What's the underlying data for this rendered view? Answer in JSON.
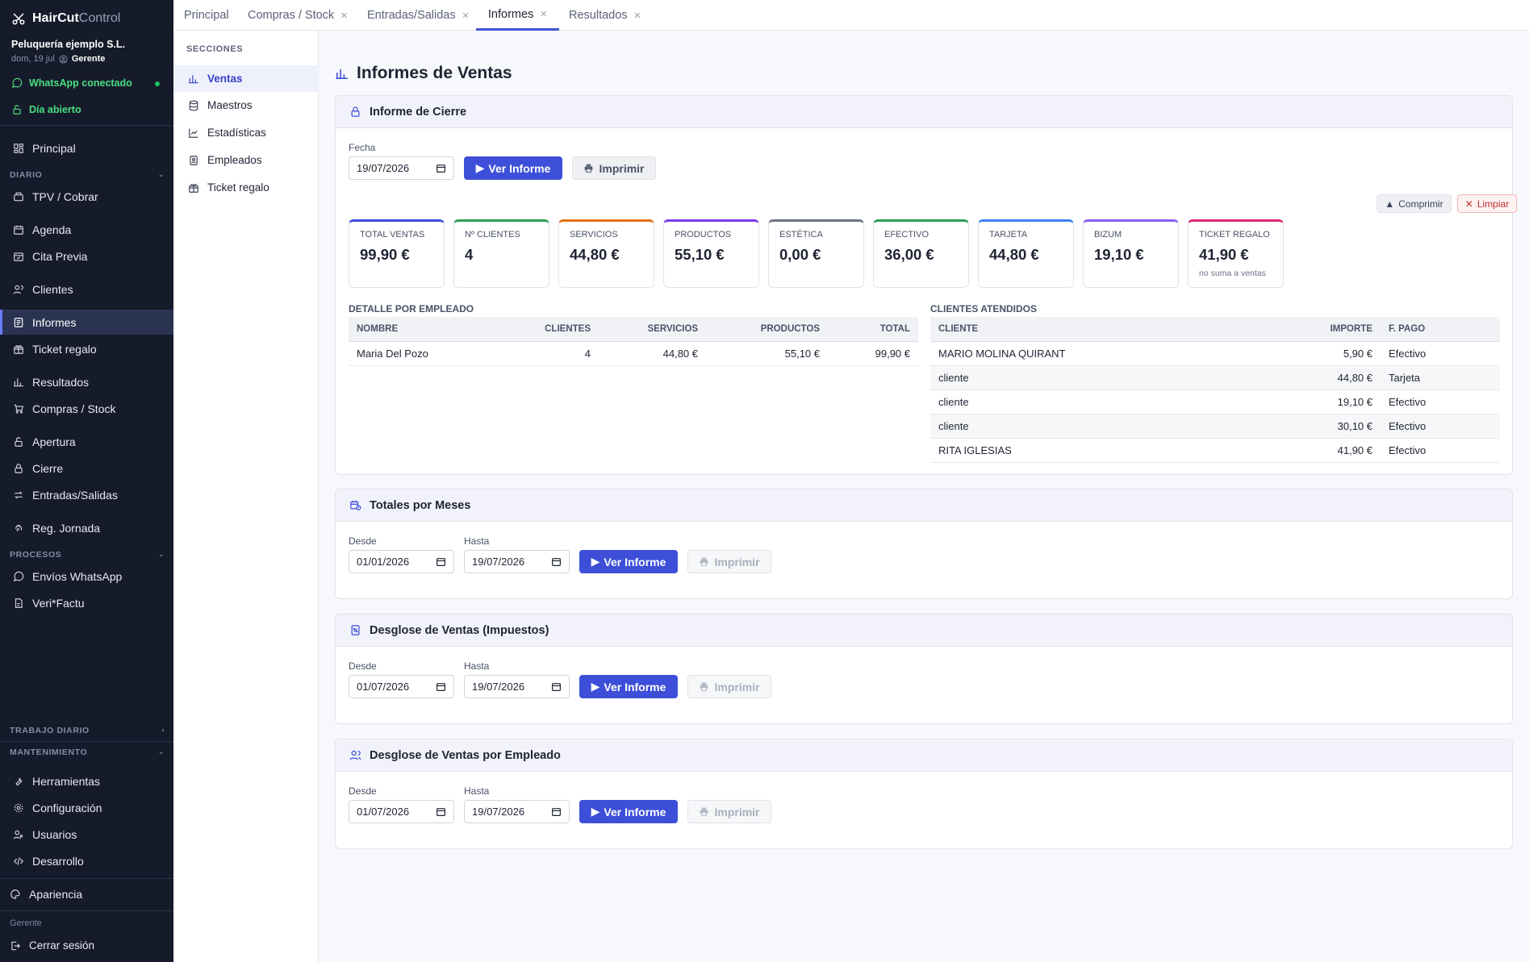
{
  "app": {
    "name_a": "HairCut",
    "name_b": "Control"
  },
  "company": "Peluquería ejemplo S.L.",
  "session": {
    "date": "dom, 19 jul",
    "role": "Gerente"
  },
  "status": {
    "whatsapp": "WhatsApp conectado",
    "day": "Día abierto"
  },
  "sidebar": {
    "principal": "Principal",
    "diario_head": "DIARIO",
    "tpv": "TPV / Cobrar",
    "agenda": "Agenda",
    "cita": "Cita Previa",
    "clientes": "Clientes",
    "informes": "Informes",
    "ticket": "Ticket regalo",
    "resultados": "Resultados",
    "compras": "Compras / Stock",
    "apertura": "Apertura",
    "cierre": "Cierre",
    "entradas": "Entradas/Salidas",
    "jornada": "Reg. Jornada",
    "procesos_head": "PROCESOS",
    "envios": "Envíos WhatsApp",
    "verifactu": "Veri*Factu",
    "trabajo_head": "TRABAJO DIARIO",
    "mant_head": "MANTENIMIENTO",
    "herramientas": "Herramientas",
    "config": "Configuración",
    "usuarios": "Usuarios",
    "desarrollo": "Desarrollo",
    "apariencia": "Apariencia",
    "footer_role": "Gerente",
    "logout": "Cerrar sesión"
  },
  "tabs": [
    "Principal",
    "Compras / Stock",
    "Entradas/Salidas",
    "Informes",
    "Resultados"
  ],
  "subnav": {
    "head": "SECCIONES",
    "items": [
      "Ventas",
      "Maestros",
      "Estadísticas",
      "Empleados",
      "Ticket regalo"
    ]
  },
  "page": {
    "title": "Informes de Ventas"
  },
  "cierre": {
    "title": "Informe de Cierre",
    "fecha_label": "Fecha",
    "fecha": "19/07/2026",
    "ver": "Ver Informe",
    "imprimir": "Imprimir",
    "comprimir": "Comprimir",
    "limpiar": "Limpiar",
    "kpis": [
      {
        "label": "TOTAL VENTAS",
        "value": "99,90 €",
        "color": "#3d4fd8"
      },
      {
        "label": "Nº CLIENTES",
        "value": "4",
        "color": "#2f9e57"
      },
      {
        "label": "SERVICIOS",
        "value": "44,80 €",
        "color": "#e2700f"
      },
      {
        "label": "PRODUCTOS",
        "value": "55,10 €",
        "color": "#7c3aed"
      },
      {
        "label": "ESTÉTICA",
        "value": "0,00 €",
        "color": "#6b7280"
      },
      {
        "label": "EFECTIVO",
        "value": "36,00 €",
        "color": "#2f9e57"
      },
      {
        "label": "TARJETA",
        "value": "44,80 €",
        "color": "#3b82f6"
      },
      {
        "label": "BIZUM",
        "value": "19,10 €",
        "color": "#8b5cf6"
      },
      {
        "label": "TICKET REGALO",
        "value": "41,90 €",
        "color": "#db2777",
        "note": "no suma a ventas"
      }
    ],
    "empleado": {
      "title": "DETALLE POR EMPLEADO",
      "headers": [
        "NOMBRE",
        "CLIENTES",
        "SERVICIOS",
        "PRODUCTOS",
        "TOTAL"
      ],
      "rows": [
        [
          "Maria Del Pozo",
          "4",
          "44,80 €",
          "55,10 €",
          "99,90 €"
        ]
      ]
    },
    "atendidos": {
      "title": "CLIENTES ATENDIDOS",
      "headers": [
        "CLIENTE",
        "IMPORTE",
        "F. PAGO"
      ],
      "rows": [
        [
          "MARIO MOLINA QUIRANT",
          "5,90 €",
          "Efectivo"
        ],
        [
          "cliente",
          "44,80 €",
          "Tarjeta"
        ],
        [
          "cliente",
          "19,10 €",
          "Efectivo"
        ],
        [
          "cliente",
          "30,10 €",
          "Efectivo"
        ],
        [
          "RITA IGLESIAS",
          "41,90 €",
          "Efectivo"
        ]
      ]
    }
  },
  "meses": {
    "title": "Totales por Meses",
    "desde_label": "Desde",
    "hasta_label": "Hasta",
    "desde": "01/01/2026",
    "hasta": "19/07/2026",
    "ver": "Ver Informe",
    "imprimir": "Imprimir"
  },
  "impuestos": {
    "title": "Desglose de Ventas (Impuestos)",
    "desde_label": "Desde",
    "hasta_label": "Hasta",
    "desde": "01/07/2026",
    "hasta": "19/07/2026",
    "ver": "Ver Informe",
    "imprimir": "Imprimir"
  },
  "porempleado": {
    "title": "Desglose de Ventas por Empleado",
    "desde_label": "Desde",
    "hasta_label": "Hasta",
    "desde": "01/07/2026",
    "hasta": "19/07/2026",
    "ver": "Ver Informe",
    "imprimir": "Imprimir"
  }
}
